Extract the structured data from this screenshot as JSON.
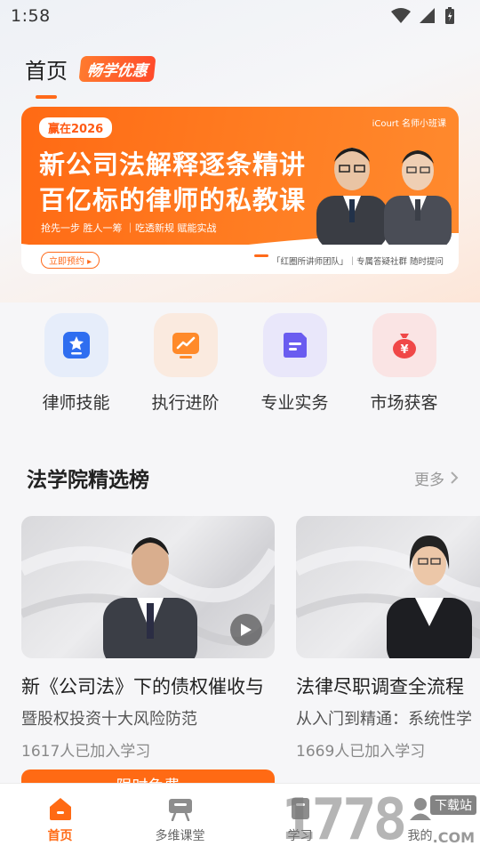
{
  "status_bar": {
    "time": "1:58"
  },
  "header": {
    "title": "首页",
    "promo_tag": "畅学优惠"
  },
  "banner": {
    "tag": "赢在2026",
    "brand": "iCourt 名师小班课",
    "line1": "新公司法解释逐条精讲",
    "line2": "百亿标的律师的私教课",
    "subtitle": "抢先一步 胜人一筹 ｜吃透新规 赋能实战",
    "cta": "立即预约 ▸",
    "footer": "「红圈所讲师团队」｜专属答疑社群 随时提问",
    "colors": {
      "primary": "#ff6a14"
    }
  },
  "categories": [
    {
      "label": "律师技能",
      "icon": "star-badge-icon",
      "bg": "#e8eefb",
      "color": "#2f6ef0"
    },
    {
      "label": "执行进阶",
      "icon": "trend-chart-icon",
      "bg": "#fbeee4",
      "color": "#ff8a2a"
    },
    {
      "label": "专业实务",
      "icon": "document-icon",
      "bg": "#ecebfb",
      "color": "#6a5cf0"
    },
    {
      "label": "市场获客",
      "icon": "money-bag-icon",
      "bg": "#fbe8e8",
      "color": "#f04848"
    }
  ],
  "section": {
    "title": "法学院精选榜",
    "more": "更多"
  },
  "courses": [
    {
      "title": "新《公司法》下的债权催收与",
      "subtitle": "暨股权投资十大风险防范",
      "count": "1617人已加入学习",
      "button": "限时免费"
    },
    {
      "title": "法律尽职调查全流程",
      "subtitle": "从入门到精通：系统性学",
      "count": "1669人已加入学习"
    }
  ],
  "tabs": [
    {
      "label": "首页",
      "icon": "home-icon",
      "active": true
    },
    {
      "label": "多维课堂",
      "icon": "classroom-icon",
      "active": false
    },
    {
      "label": "学习",
      "icon": "book-icon",
      "active": false
    },
    {
      "label": "我的",
      "icon": "profile-icon",
      "active": false
    }
  ],
  "watermark": {
    "text": "1778",
    "badge": "下载站",
    "domain": ".COM"
  }
}
